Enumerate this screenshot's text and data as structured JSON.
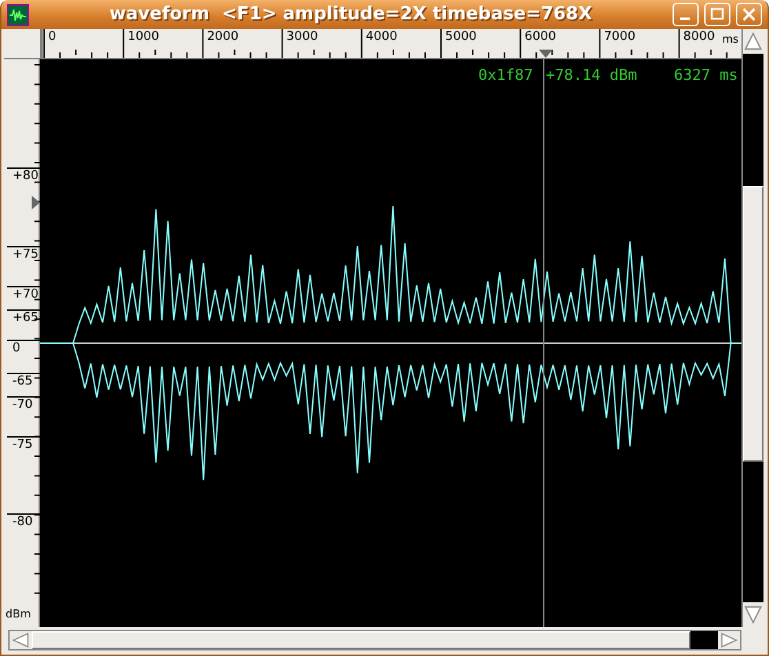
{
  "window": {
    "title": "waveform  <F1> amplitude=2X timebase=768X"
  },
  "ruler": {
    "ticks": [
      "0",
      "1000",
      "2000",
      "3000",
      "4000",
      "5000",
      "6000",
      "7000",
      "8000"
    ],
    "unit": "ms"
  },
  "readout": {
    "sample": "0x1f87",
    "level": "+78.14 dBm",
    "time": "6327 ms"
  },
  "axis": {
    "labels": [
      "+80",
      "+75",
      "+70",
      "+65",
      "0",
      "-65",
      "-70",
      "-75",
      "-80"
    ],
    "unit": "dBm"
  }
}
